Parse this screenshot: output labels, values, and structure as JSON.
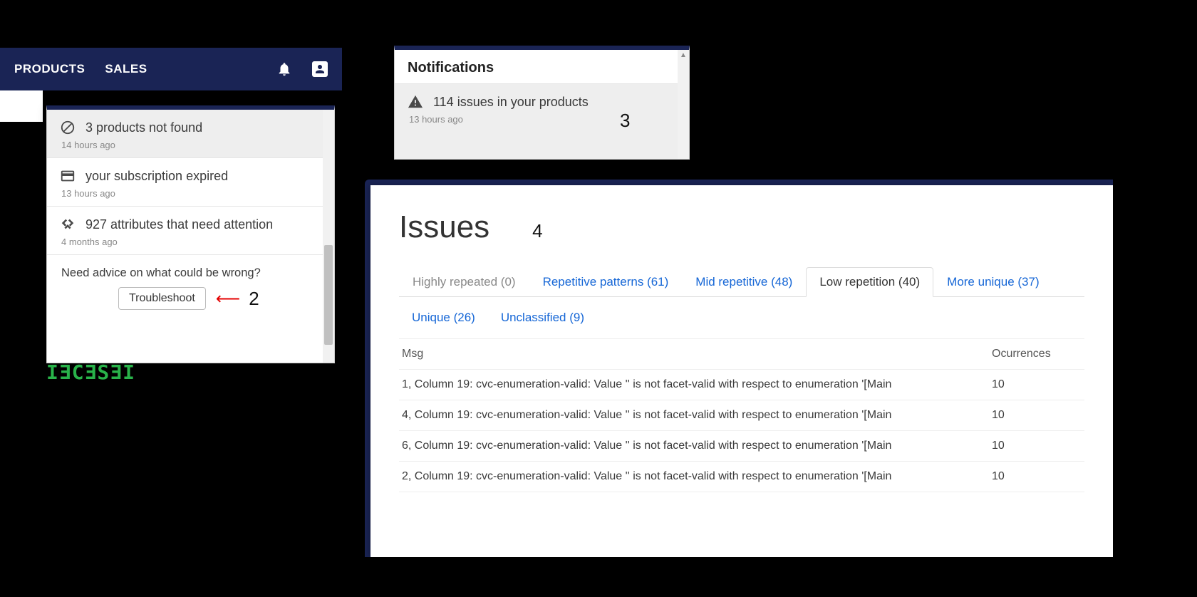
{
  "nav": {
    "products": "PRODUCTS",
    "sales": "SALES"
  },
  "dropdown1": {
    "items": [
      {
        "icon": "block",
        "text": "3 products not found",
        "time": "14 hours ago"
      },
      {
        "icon": "card",
        "text": "your subscription expired",
        "time": "13 hours ago"
      },
      {
        "icon": "hands",
        "text": "927 attributes that need attention",
        "time": "4 months ago"
      }
    ],
    "footer_text": "Need advice on what could be wrong?",
    "button": "Troubleshoot",
    "step": "2"
  },
  "panel3": {
    "title": "Notifications",
    "item_text": "114 issues in your products",
    "item_time": "13 hours ago",
    "step": "3"
  },
  "issues": {
    "title": "Issues",
    "step": "4",
    "tabs": [
      {
        "label": "Highly repeated (0)",
        "kind": "muted"
      },
      {
        "label": "Repetitive patterns (61)",
        "kind": "link"
      },
      {
        "label": "Mid repetitive (48)",
        "kind": "link"
      },
      {
        "label": "Low repetition (40)",
        "kind": "active"
      },
      {
        "label": "More unique (37)",
        "kind": "link"
      }
    ],
    "tabs_row2": [
      {
        "label": "Unique (26)",
        "kind": "link"
      },
      {
        "label": "Unclassified (9)",
        "kind": "link"
      }
    ],
    "columns": {
      "msg": "Msg",
      "occ": "Ocurrences"
    },
    "rows": [
      {
        "msg": "1, Column 19: cvc-enumeration-valid: Value '' is not facet-valid with respect to enumeration '[Main",
        "occ": "10"
      },
      {
        "msg": "4, Column 19: cvc-enumeration-valid: Value '' is not facet-valid with respect to enumeration '[Main",
        "occ": "10"
      },
      {
        "msg": "6, Column 19: cvc-enumeration-valid: Value '' is not facet-valid with respect to enumeration '[Main",
        "occ": "10"
      },
      {
        "msg": "2, Column 19: cvc-enumeration-valid: Value '' is not facet-valid with respect to enumeration '[Main",
        "occ": "10"
      }
    ]
  },
  "fragments": {
    "green_text": "IƎCƎSƎI"
  }
}
